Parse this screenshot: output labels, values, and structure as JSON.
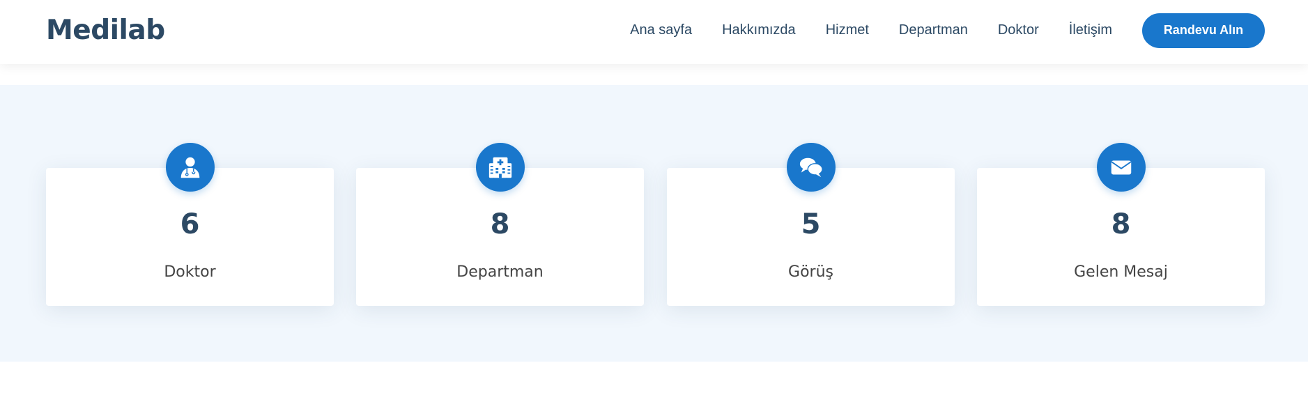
{
  "brand": {
    "logo": "Medilab"
  },
  "nav": {
    "items": [
      {
        "label": "Ana sayfa"
      },
      {
        "label": "Hakkımızda"
      },
      {
        "label": "Hizmet"
      },
      {
        "label": "Departman"
      },
      {
        "label": "Doktor"
      },
      {
        "label": "İletişim"
      }
    ],
    "cta_label": "Randevu Alın"
  },
  "colors": {
    "accent": "#1977cc",
    "heading": "#2c4964",
    "section_bg": "#f1f7fd"
  },
  "stats": [
    {
      "icon": "doctor-icon",
      "count": "6",
      "label": "Doktor"
    },
    {
      "icon": "hospital-icon",
      "count": "8",
      "label": "Departman"
    },
    {
      "icon": "comments-icon",
      "count": "5",
      "label": "Görüş"
    },
    {
      "icon": "envelope-icon",
      "count": "8",
      "label": "Gelen Mesaj"
    }
  ]
}
